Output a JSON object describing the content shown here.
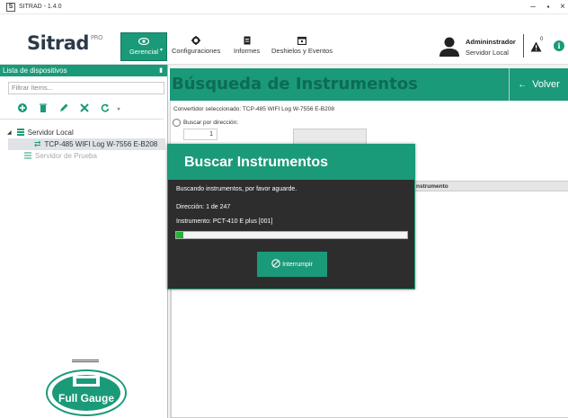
{
  "window": {
    "title": "SITRAD - 1.4.0",
    "icon_letter": "S"
  },
  "header": {
    "logo": "Sitrad",
    "logo_sup": "PRO",
    "nav": [
      {
        "label": "Gerencial",
        "icon": "eye-icon",
        "active": true
      },
      {
        "label": "Configuraciones",
        "icon": "gear-icon"
      },
      {
        "label": "Informes",
        "icon": "document-icon"
      },
      {
        "label": "Deshielos y Eventos",
        "icon": "calendar-icon"
      }
    ],
    "user_name": "Admininstrador",
    "user_server": "Servidor Local",
    "alerts_count": "0"
  },
  "sidebar": {
    "title": "Lista de dispositivos",
    "filter_placeholder": "Filtrar ítems...",
    "tools": [
      "add-icon",
      "delete-icon",
      "edit-icon",
      "tools-icon",
      "refresh-icon"
    ],
    "tree": [
      {
        "label": "Servidor Local",
        "level": 0,
        "expanded": true
      },
      {
        "label": "TCP-485 WIFI Log W-7556 E-B208",
        "level": 1,
        "selected": true
      },
      {
        "label": "Servidor de Prueba",
        "level": 0,
        "disabled": true
      }
    ],
    "brand_text": "Full Gauge"
  },
  "main": {
    "title": "Búsqueda de Instrumentos",
    "back_label": "Volver",
    "converter_text": "Convertidor seleccionado: TCP-485 WIFI Log W-7556 E-B208",
    "search_by_address_label": "Buscar por dirección:",
    "address_value": "1",
    "grid_header": "nstrumento"
  },
  "modal": {
    "title": "Buscar Instrumentos",
    "status": "Buscando instrumentos, por favor aguarde.",
    "address_line": "Dirección: 1 de 247",
    "instrument_line": "Instrumento: PCT-410 E plus [001]",
    "progress": 0.03,
    "button_label": "Interrumpir"
  },
  "colors": {
    "accent": "#1a9a78",
    "dark": "#2d2d2d",
    "progress": "#27b038"
  }
}
